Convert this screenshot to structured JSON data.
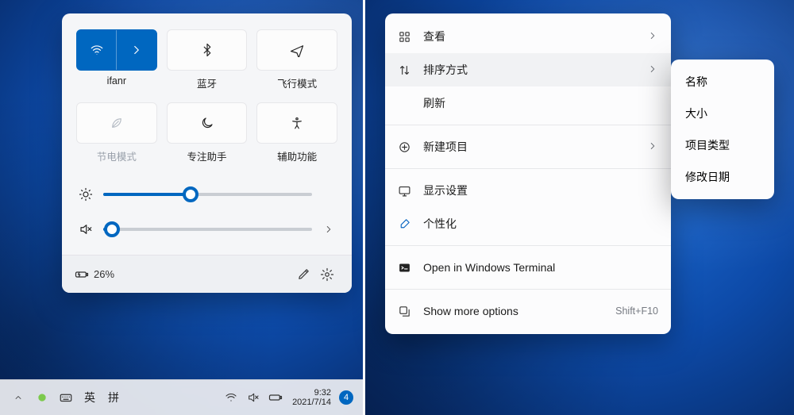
{
  "quick_settings": {
    "tiles": [
      {
        "label": "ifanr"
      },
      {
        "label": "蓝牙"
      },
      {
        "label": "飞行模式"
      },
      {
        "label": "节电模式"
      },
      {
        "label": "专注助手"
      },
      {
        "label": "辅助功能"
      }
    ],
    "brightness_pct": 42,
    "volume_pct": 4,
    "battery_text": "26%"
  },
  "taskbar": {
    "ime1": "英",
    "ime2": "拼",
    "time": "9:32",
    "date": "2021/7/14",
    "notif_count": "4"
  },
  "context_menu": {
    "items": [
      {
        "label": "查看"
      },
      {
        "label": "排序方式"
      },
      {
        "label": "刷新"
      },
      {
        "label": "新建项目"
      },
      {
        "label": "显示设置"
      },
      {
        "label": "个性化"
      },
      {
        "label": "Open in Windows Terminal"
      },
      {
        "label": "Show more options",
        "hint": "Shift+F10"
      }
    ],
    "submenu": [
      "名称",
      "大小",
      "项目类型",
      "修改日期"
    ]
  }
}
